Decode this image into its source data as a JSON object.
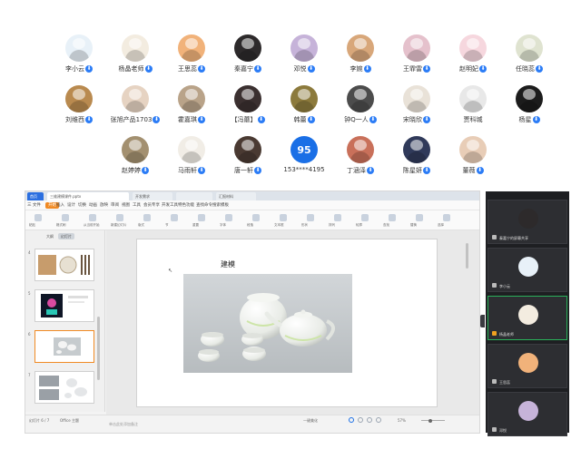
{
  "participants": [
    {
      "name": "李小云",
      "color": "#e8f1f8",
      "verified": true
    },
    {
      "name": "杨晶老师",
      "color": "#f3ece0",
      "verified": true
    },
    {
      "name": "王思蕊",
      "color": "#f1b27a",
      "verified": true
    },
    {
      "name": "秦嘉宁",
      "color": "#2d2a2b",
      "verified": true
    },
    {
      "name": "邓悦",
      "color": "#c6b3d9",
      "verified": true
    },
    {
      "name": "李婉",
      "color": "#d8a77a",
      "verified": true
    },
    {
      "name": "王霏雷",
      "color": "#e5c1cc",
      "verified": true
    },
    {
      "name": "赵明妃",
      "color": "#f6d7de",
      "verified": true
    },
    {
      "name": "任晓蕊",
      "color": "#dfe3d0",
      "verified": true
    },
    {
      "name": "刘维西",
      "color": "#b98a4f",
      "verified": true
    },
    {
      "name": "张旭产品1703",
      "color": "#e6d3c2",
      "verified": true
    },
    {
      "name": "霍嘉琪",
      "color": "#b9a389",
      "verified": true
    },
    {
      "name": "【冯蘑】",
      "color": "#3b3030",
      "verified": true
    },
    {
      "name": "韩蕾",
      "color": "#8c7a3c",
      "verified": true
    },
    {
      "name": "钟Q一人",
      "color": "#4c4c4c",
      "verified": true
    },
    {
      "name": "宋晓欣",
      "color": "#e9e2d8",
      "verified": true
    },
    {
      "name": "贾科城",
      "color": "#e8e8e8",
      "verified": false
    },
    {
      "name": "杨星",
      "color": "#1c1c1c",
      "verified": true
    },
    {
      "name": "赵婷婷",
      "color": "#a39070",
      "verified": true
    },
    {
      "name": "马雨轩",
      "color": "#f1ede6",
      "verified": true
    },
    {
      "name": "唐一轩",
      "color": "#4a3a32",
      "verified": true
    },
    {
      "name": "153****4195",
      "color": "#1a6fe6",
      "number": "95",
      "verified": false
    },
    {
      "name": "丁涵泽",
      "color": "#c9705a",
      "verified": true
    },
    {
      "name": "陈星妍",
      "color": "#303a5a",
      "verified": true
    },
    {
      "name": "董薇",
      "color": "#e8cdb7",
      "verified": true
    }
  ],
  "wps": {
    "tabs": [
      "首页",
      "三维建模课件.pptx",
      "开发需求",
      "",
      "汇报材料"
    ],
    "menu": [
      "三 文件",
      "开始",
      "插入",
      "设计",
      "切换",
      "动画",
      "放映",
      "审阅",
      "视图",
      "工具",
      "会员专享",
      "开发工具",
      "特色功能",
      "查找命令",
      "搜索模板"
    ],
    "ribbon_labels": [
      "粘贴",
      "格式刷",
      "从当前开始",
      "新建幻灯片",
      "版式",
      "节",
      "重置",
      "字体",
      "段落",
      "文本框",
      "形状",
      "排列",
      "轮廓",
      "查找",
      "替换",
      "选择"
    ],
    "pane_tabs": [
      "大纲",
      "幻灯片"
    ],
    "thumb_numbers": [
      "4",
      "5",
      "6",
      "7"
    ],
    "slide_title": "建模",
    "notes_placeholder": "单击此处添加备注",
    "status_left": [
      "幻灯片 6 / 7",
      "Office 主题"
    ],
    "status_right": [
      "一键美化",
      "57%"
    ]
  },
  "video": [
    {
      "name": "秦嘉宁的屏幕共享",
      "color": "#2d2a2b"
    },
    {
      "name": "李小云",
      "color": "#e8f1f8"
    },
    {
      "name": "杨晶老师",
      "color": "#f3ece0"
    },
    {
      "name": "王思蕊",
      "color": "#f1b27a"
    },
    {
      "name": "邓悦",
      "color": "#c6b3d9"
    }
  ]
}
